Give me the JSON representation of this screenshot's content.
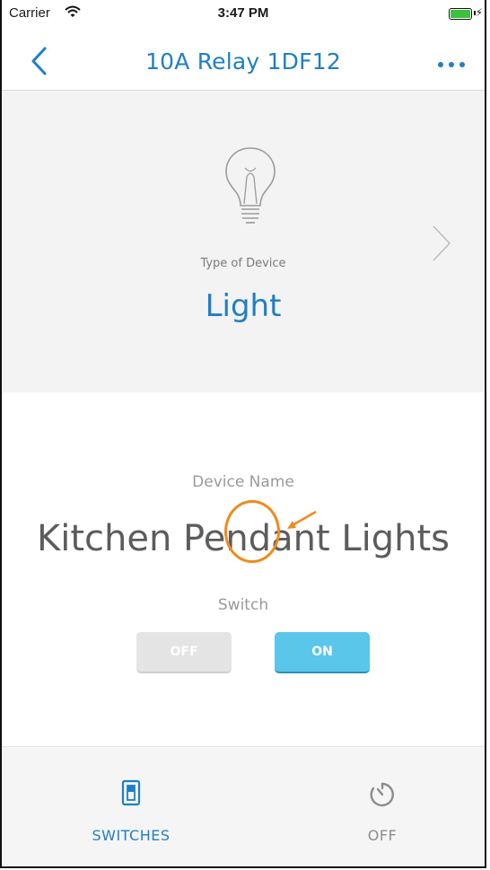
{
  "status_bar": {
    "carrier": "Carrier",
    "time": "3:47 PM",
    "charging_symbol": "⚡"
  },
  "nav": {
    "title": "10A Relay 1DF12",
    "back_icon": "chevron-left-icon",
    "more_icon": "more-horizontal-icon"
  },
  "device_type": {
    "label": "Type of Device",
    "value": "Light",
    "icon": "lightbulb-icon"
  },
  "device_name": {
    "label": "Device Name",
    "value": "Kitchen Pendant Lights"
  },
  "switch": {
    "label": "Switch",
    "off_label": "OFF",
    "on_label": "ON",
    "state": "ON"
  },
  "tabs": [
    {
      "label": "SWITCHES",
      "icon": "switch-icon",
      "active": true
    },
    {
      "label": "OFF",
      "icon": "timer-icon",
      "active": false
    }
  ],
  "colors": {
    "accent": "#1f7fc4",
    "on_button": "#5ac6ea",
    "annotation": "#f08a1c"
  }
}
